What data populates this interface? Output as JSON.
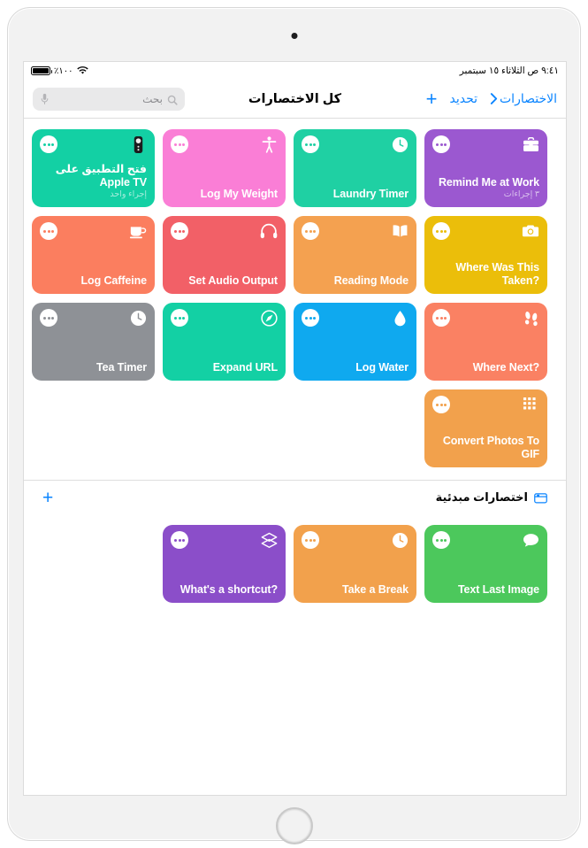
{
  "status_bar": {
    "battery_percent": "٪١٠٠",
    "battery_icon": "battery-icon",
    "wifi_icon": "wifi-icon",
    "datetime": "٩:٤١ ص   الثلاثاء ١٥ سبتمبر"
  },
  "nav": {
    "back_label": "الاختصارات",
    "select_label": "تحديد",
    "add_label": "+",
    "title": "كل الاختصارات"
  },
  "search": {
    "placeholder": "بحث",
    "value": "",
    "search_icon": "search-icon",
    "mic_icon": "microphone-icon"
  },
  "colors": {
    "accent": "#0a84ff",
    "purple": "#9b58d0",
    "teal": "#1fd0a3",
    "pink": "#fa7ed6",
    "green_teal": "#13d0a4",
    "yellow": "#ebbe0a",
    "orange_light": "#f4a150",
    "red": "#f26067",
    "coral": "#fb7e5f",
    "salmon": "#fa8163",
    "blue": "#0fa9ef",
    "gray": "#8e9196",
    "orange": "#f2a14c",
    "green": "#4cc85c",
    "purple_deep": "#8b4ec9"
  },
  "shortcuts": [
    {
      "title": "Remind Me at Work",
      "subtitle": "٣ إجراءات",
      "color": "#9b58d0",
      "icon": "briefcase-icon",
      "rtl": false
    },
    {
      "title": "Laundry Timer",
      "subtitle": "",
      "color": "#1fd0a3",
      "icon": "clock-icon",
      "rtl": false
    },
    {
      "title": "Log My Weight",
      "subtitle": "",
      "color": "#fa7ed6",
      "icon": "accessibility-icon",
      "rtl": false
    },
    {
      "title": "فتح التطبيق على Apple TV",
      "subtitle": "إجراء واحد",
      "color": "#13d0a4",
      "icon": "apple-tv-remote-icon",
      "rtl": true
    },
    {
      "title": "Where Was This Taken?",
      "subtitle": "",
      "color": "#ebbe0a",
      "icon": "camera-icon",
      "rtl": false
    },
    {
      "title": "Reading Mode",
      "subtitle": "",
      "color": "#f4a150",
      "icon": "book-icon",
      "rtl": false
    },
    {
      "title": "Set Audio Output",
      "subtitle": "",
      "color": "#f26067",
      "icon": "headphones-icon",
      "rtl": false
    },
    {
      "title": "Log Caffeine",
      "subtitle": "",
      "color": "#fb7e5f",
      "icon": "coffee-cup-icon",
      "rtl": false
    },
    {
      "title": "Where Next?",
      "subtitle": "",
      "color": "#fa8163",
      "icon": "footprints-icon",
      "rtl": false
    },
    {
      "title": "Log Water",
      "subtitle": "",
      "color": "#0fa9ef",
      "icon": "water-drop-icon",
      "rtl": false
    },
    {
      "title": "Expand URL",
      "subtitle": "",
      "color": "#13d0a4",
      "icon": "safari-compass-icon",
      "rtl": false
    },
    {
      "title": "Tea Timer",
      "subtitle": "",
      "color": "#8e9196",
      "icon": "clock-icon",
      "rtl": false
    },
    {
      "title": "Convert Photos To GIF",
      "subtitle": "",
      "color": "#f2a14c",
      "icon": "grid-dots-icon",
      "rtl": false
    }
  ],
  "starter_section": {
    "folder_icon": "folder-icon",
    "title": "اختصارات مبدئية",
    "add_label": "+",
    "shortcuts": [
      {
        "title": "Text Last Image",
        "subtitle": "",
        "color": "#4cc85c",
        "icon": "message-bubble-icon",
        "rtl": false
      },
      {
        "title": "Take a Break",
        "subtitle": "",
        "color": "#f2a14c",
        "icon": "clock-icon",
        "rtl": false
      },
      {
        "title": "What's a shortcut?",
        "subtitle": "",
        "color": "#8b4ec9",
        "icon": "layers-icon",
        "rtl": false
      }
    ]
  }
}
